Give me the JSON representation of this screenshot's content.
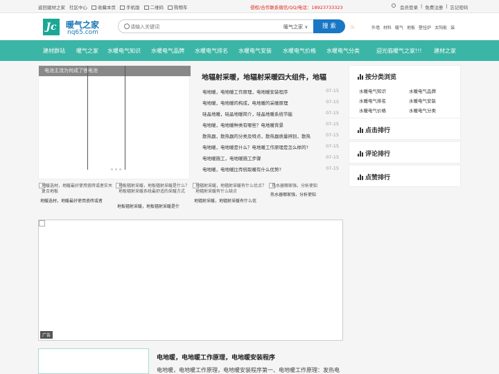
{
  "topbar": {
    "links": [
      "返回建材之家",
      "社区中心",
      "收藏本页",
      "手机版",
      "二维码",
      "购物车"
    ],
    "notice": "侵权/合作联系微信/QQ/电话：18923733323",
    "account": [
      "会员登录",
      "|",
      "免费注册",
      "|",
      "忘记密码"
    ]
  },
  "header": {
    "logo_mark": "Jc",
    "site_name": "暖气之家",
    "site_url": "nq65.com",
    "search_placeholder": "请输入关键词",
    "search_scope": "暖气之家 ∨",
    "search_button": "搜 索",
    "quick_links": [
      "外墙",
      "材料",
      "暖气",
      "地板",
      "壁挂炉",
      "太阳能",
      "装"
    ]
  },
  "nav": [
    "建材群站",
    "暖气之家",
    "水暖电气知识",
    "水暖电气品牌",
    "水暖电气排名",
    "水暖电气安装",
    "水暖电气价格",
    "水暖电气分类",
    "迎光临暖气之家!!!",
    "建材之家"
  ],
  "slider": {
    "caption": "电池主流为何成了锂电池"
  },
  "headline": "地辐射采暖，地辐射采暖四大组件，地辐",
  "news": [
    {
      "title": "电地暖，电地暖工作原理，电地暖安装程序",
      "date": "07-15"
    },
    {
      "title": "电地暖，电地暖的构成，电地暖的采暖原理",
      "date": "07-15"
    },
    {
      "title": "硅晶地暖，硅晶地暖简介，硅晶地暖系统节能",
      "date": "07-15"
    },
    {
      "title": "电地暖，电地暖种类有哪些？电地暖背景",
      "date": "07-15"
    },
    {
      "title": "散热器，散热器的分类及特点，散热器质量辨别，散热",
      "date": "07-15"
    },
    {
      "title": "电地暖，电地暖是什么？电地暖工作原理是怎么样的?",
      "date": "07-15"
    },
    {
      "title": "电地暖施工，电地暖施工步骤",
      "date": "07-15"
    },
    {
      "title": "电地暖，电地暖比传统取暖有什么优势?",
      "date": "07-15"
    }
  ],
  "thumbs": [
    {
      "alt": "地暖选材，地暖最好使用瓷砖或者实木复合地板",
      "caption": "地暖选材，地暖最好使用瓷砖或者"
    },
    {
      "alt": "地板辐射采暖，地板辐射采暖是什么？地板辐射采暖系统最舒适的采暖方式",
      "caption": "地板辐射采暖，地板辐射采暖是什"
    },
    {
      "alt": "地辐射采暖，地辐射采暖有什么优点？地辐射采暖有什么缺点",
      "caption": "地辐射采暖，地辐射采暖有什么优"
    },
    {
      "alt": "热水器哪家强，分析使知",
      "caption": "热水器哪家强，分析使知"
    }
  ],
  "ad": {
    "tag": "广告"
  },
  "article": {
    "title": "电地暖，电地暖工作原理，电地暖安装程序",
    "desc": "电地暖，电地暖工作原理，电地暖安装程序第一、电地暖工作原理：发热电"
  },
  "sidebar": {
    "categories_title": "按分类浏览",
    "categories": [
      "水暖电气知识",
      "水暖电气品牌",
      "水暖电气排名",
      "水暖电气安装",
      "水暖电气价格",
      "水暖电气分类"
    ],
    "rank_click": "点击排行",
    "rank_comment": "评论排行",
    "rank_like": "点赞排行"
  }
}
